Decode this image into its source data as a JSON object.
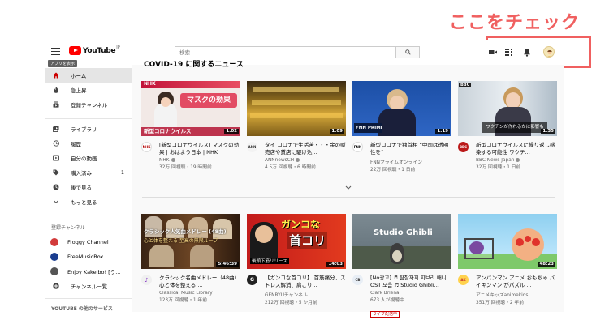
{
  "callout": {
    "text": "ここをチェック"
  },
  "header": {
    "logo_text": "YouTube",
    "logo_sup": "JP",
    "search_placeholder": "検索"
  },
  "sidebar": {
    "tooltip": "アプリを表示",
    "nav": [
      {
        "label": "ホーム",
        "icon": "home-icon",
        "active": true
      },
      {
        "label": "急上昇",
        "icon": "flame-icon"
      },
      {
        "label": "登録チャンネル",
        "icon": "subscriptions-icon"
      }
    ],
    "library": [
      {
        "label": "ライブラリ",
        "icon": "library-icon"
      },
      {
        "label": "履歴",
        "icon": "history-icon"
      },
      {
        "label": "自分の動画",
        "icon": "my-videos-icon"
      },
      {
        "label": "購入済み",
        "icon": "purchases-icon",
        "count": "1"
      },
      {
        "label": "後で見る",
        "icon": "watch-later-icon"
      },
      {
        "label": "もっと見る",
        "icon": "chevron-down-icon"
      }
    ],
    "subs_heading": "登録チャンネル",
    "subs": [
      {
        "label": "Froggy Channel",
        "color": "#d23b3b"
      },
      {
        "label": "FreeMusicBox",
        "color": "#1a3d8f"
      },
      {
        "label": "Enjoy Kakeibo! [う...",
        "color": "#555555"
      },
      {
        "label": "チャンネル一覧",
        "icon": "add-circle-icon"
      }
    ],
    "footer_heading": "YOUTUBE の他のサービス"
  },
  "main": {
    "section_title": "COVID-19 に関するニュース",
    "row1": [
      {
        "title": "[新型コロナウイルス] マスクの効果 | おはよう日本 | NHK",
        "channel": "NHK",
        "meta": "32万 回視聴・19 時間前",
        "duration": "1:02",
        "avatar_text": "NHK",
        "avatar_bg": "#ffffff",
        "avatar_fg": "#b30000",
        "thumb_text": "マスクの効果",
        "thumb_sub": "新型コロナウイルス",
        "brand": "NHK"
      },
      {
        "title": "タイ コロナで生活苦・・・金の販売店や質店に駆け込...",
        "channel": "ANNnewsCH",
        "meta": "4.5万 回視聴・6 時間前",
        "duration": "1:09",
        "avatar_text": "ANN",
        "avatar_bg": "#f3f3f3",
        "avatar_fg": "#333333"
      },
      {
        "title": "新型コロナで独首相 “中国は透明性を”",
        "channel": "FNNプライムオンライン",
        "meta": "22万 回視聴・1 日前",
        "duration": "1:19",
        "avatar_text": "FNN",
        "avatar_bg": "#ffffff",
        "avatar_fg": "#000000",
        "brand": "FNN PRIME"
      },
      {
        "title": "新型コロナウイルスに繰り返し感染する可能性 ワクチ...",
        "channel": "BBC News Japan",
        "meta": "32万 回視聴・1 日前",
        "duration": "1:35",
        "avatar_text": "BBC",
        "avatar_bg": "#bb1919",
        "avatar_fg": "#ffffff",
        "thumb_sub": "ワクチンが作れるかに影響も",
        "brand": "BBC"
      }
    ],
    "row2": [
      {
        "title": "クラシック名曲メドレー（48曲）心と体を整える ...",
        "channel": "Classical Music Library",
        "meta": "123万 回視聴・1 年前",
        "duration": "5:46:39",
        "avatar_text": "♪",
        "avatar_bg": "#f0f0f0",
        "avatar_fg": "#8a3fc7",
        "thumb_text": "クラシック人気曲メドレー (48曲)",
        "thumb_sub": "心と体を整える 至高の無限ループ"
      },
      {
        "title": "【ガンコな首コリ】 首筋痛分、ストレス解消、肩こり...",
        "channel": "GENRYUチャンネル",
        "meta": "212万 回視聴・5 か月前",
        "duration": "14:03",
        "avatar_text": "G",
        "avatar_bg": "#222222",
        "avatar_fg": "#ffffff",
        "thumb_text": "ガンコな",
        "thumb_text2": "首コリ",
        "thumb_sub": "後頭下筋リリース"
      },
      {
        "title": "[No광고] ♬ 잠잘자지 지브리 애니 OST 모음 ♬ Studio Ghibli...",
        "channel": "Clark Briena",
        "meta": "673 人が視聴中",
        "live": "ライブ配信中",
        "avatar_text": "CB",
        "avatar_bg": "#e8eef5",
        "avatar_fg": "#333333",
        "thumb_text": "Studio Ghibli"
      },
      {
        "title": "アンパンマン アニメ おもちゃ バイキンマン がパズル ...",
        "channel": "アニメキッズanimekids",
        "meta": "351万 回視聴・2 年前",
        "duration": "48:23",
        "avatar_text": "AK",
        "avatar_bg": "#ffd24d",
        "avatar_fg": "#c62828"
      }
    ]
  }
}
